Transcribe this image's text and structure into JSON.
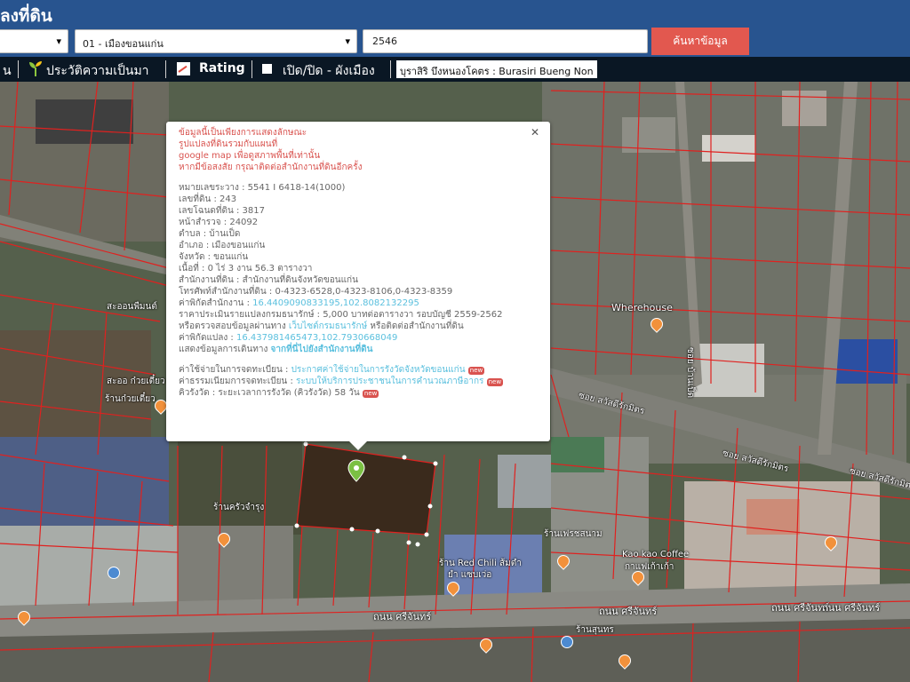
{
  "app": {
    "title": "ลงที่ดิน"
  },
  "search": {
    "province_value": "",
    "district_value": "01 - เมืองขอนแก่น",
    "parcel_value": "2546",
    "search_button": "ค้นหาข้อมูล"
  },
  "toolbar": {
    "item_left": "น",
    "history": "ประวัติความเป็นมา",
    "rating": "Rating",
    "toggle_city_plan": "เปิด/ปิด - ผังเมือง",
    "location_field": "บุราสิริ บึงหนองโคตร : Burasiri Bueng Non"
  },
  "popup": {
    "warning": [
      "ข้อมูลนี้เป็นเพียงการแสดงลักษณะ",
      "รูปแปลงที่ดินรวมกับแผนที่",
      "google map เพื่อดูสภาพพื้นที่เท่านั้น",
      "หากมีข้อสงสัย กรุณาติดต่อสำนักงานที่ดินอีกครั้ง"
    ],
    "fields": {
      "map_sheet": "หมายเลขระวาง : 5541 I 6418-14(1000)",
      "parcel_no": "เลขที่ดิน : 243",
      "land_no": "เลขโฉนดที่ดิน : 3817",
      "survey_page": "หน้าสำรวจ : 24092",
      "subdistrict": "ตำบล : บ้านเป็ด",
      "district": "อำเภอ : เมืองขอนแก่น",
      "province": "จังหวัด : ขอนแก่น",
      "area": "เนื้อที่ : 0 ไร่ 3 งาน 56.3 ตารางวา",
      "office": "สำนักงานที่ดิน : สำนักงานที่ดินจังหวัดขอนแก่น",
      "office_phone": "โทรศัพท์สำนักงานที่ดิน : 0-4323-6528,0-4323-8106,0-4323-8359",
      "office_coord_label": "ค่าพิกัดสำนักงาน : ",
      "office_coord": "16.4409090833195,102.8082132295",
      "price_line": "ราคาประเมินรายแปลงกรมธนารักษ์ : 5,000 บาทต่อตารางวา รอบบัญชี 2559-2562",
      "check_prefix": "หรือตรวจสอบข้อมูลผ่านทาง ",
      "check_link": "เว็บไซต์กรมธนารักษ์",
      "check_suffix": " หรือติดต่อสำนักงานที่ดิน",
      "parcel_coord_label": "ค่าพิกัดแปลง : ",
      "parcel_coord": "16.437981465473,102.7930668049",
      "route_prefix": "แสดงข้อมูลการเดินทาง ",
      "route_link": "จากที่นี่ไปยังสำนักงานที่ดิน"
    },
    "fees": {
      "reg_fee_label": "ค่าใช้จ่ายในการจดทะเบียน : ",
      "reg_fee_link": "ประกาศค่าใช้จ่ายในการรังวัดจังหวัดขอนแก่น",
      "service_label": "ค่าธรรมเนียมการจดทะเบียน : ",
      "service_link": "ระบบให้บริการประชาชนในการคำนวณภาษีอากร",
      "queue_line": "คิวรังวัด : ระยะเวลาการรังวัด (คิวรังวัด) 58 วัน",
      "badge_new": "new"
    }
  },
  "map": {
    "labels": {
      "wherehouse": "Wherehouse",
      "kaokao": "Kao kao Coffee",
      "kaokao_th": "กาแฟเก้าเก้า",
      "redchili": "ร้าน Red Chili ส้มตำ",
      "redchili2": "ยำ แซบเว่อ",
      "road_main_1": "ถนน ศรีจันทร์",
      "road_main_2": "ถนน ศรีจันทร์",
      "road_main_3": "ถนน ศรีจันทร์",
      "road_main_4": "ถนน ศรีจันทร์",
      "road_side": "ซอย สวัสดีรักมิตร",
      "road_side2": "ซอย สวัสดีรักมิตร",
      "road_side3": "ซอย สวัสดีรักมิตร",
      "road_vertical": "ซอย บ้านเป็ด",
      "shop1": "ร้านครัวจำรุง",
      "shop2": "ร้านสุนทร",
      "shop3": "ร้านเฟรชสนาม",
      "left1": "สะออนพืมนต์",
      "left2": "สะออ ก๋วยเตี๋ยว",
      "left3": "ร้านก๋วยเตี๋ยว"
    }
  },
  "colors": {
    "header_bg": "#28548f",
    "toolbar_bg": "#0a1724",
    "search_button": "#e2584f",
    "parcel_line": "#e0211f",
    "highlight_parcel": "#3a2a1c",
    "warning_text": "#d9534f",
    "link_text": "#5bc0de"
  },
  "icons": {
    "history_icon": "sprout-icon",
    "rating_icon": "chart-icon",
    "toggle_icon": "checkbox-icon",
    "popup_close": "close-icon",
    "parcel_marker": "location-pin-icon"
  }
}
